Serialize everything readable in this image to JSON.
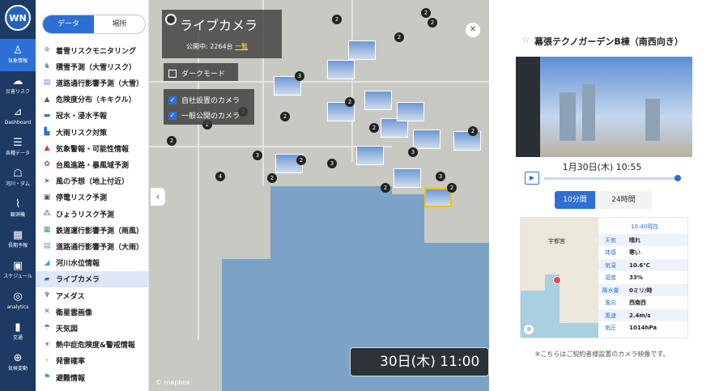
{
  "rail": {
    "logo": "WN",
    "items": [
      {
        "label": "気象情報",
        "icon": "person-pin-icon",
        "glyph": "♙"
      },
      {
        "label": "災害リスク",
        "icon": "tornado-icon",
        "glyph": "☁"
      },
      {
        "label": "Dashboard",
        "icon": "chart-icon",
        "glyph": "⊿"
      },
      {
        "label": "各種データ",
        "icon": "database-icon",
        "glyph": "☰"
      },
      {
        "label": "河川・ダム",
        "icon": "river-icon",
        "glyph": "☖"
      },
      {
        "label": "観測機",
        "icon": "graph-icon",
        "glyph": "⌇"
      },
      {
        "label": "長期予報",
        "icon": "calendar-icon",
        "glyph": "▦"
      },
      {
        "label": "スケジュール",
        "icon": "schedule-icon",
        "glyph": "▣"
      },
      {
        "label": "analytics",
        "icon": "analytics-icon",
        "glyph": "◎"
      },
      {
        "label": "交通",
        "icon": "truck-icon",
        "glyph": "▮"
      },
      {
        "label": "気候変動",
        "icon": "globe-icon",
        "glyph": "⊕"
      }
    ]
  },
  "menu": {
    "tabs": [
      "データ",
      "場所"
    ],
    "items": [
      {
        "label": "着雪リスクモニタリング",
        "glyph": "❄",
        "color": "#5b8fd6"
      },
      {
        "label": "積雪予測（大雪リスク）",
        "glyph": "♞",
        "color": "#5b8fd6"
      },
      {
        "label": "道路通行影響予測（大雪）",
        "glyph": "▤",
        "color": "#5b8fd6"
      },
      {
        "label": "危険度分布（キキクル）",
        "glyph": "▲",
        "color": "#7a5a3a"
      },
      {
        "label": "冠水・浸水予報",
        "glyph": "▬",
        "color": "#3a78c8"
      },
      {
        "label": "大雨リスク対策",
        "glyph": "▙",
        "color": "#2e6fd6"
      },
      {
        "label": "気象警報・可能性情報",
        "glyph": "▲",
        "color": "#e33b2e"
      },
      {
        "label": "台風進路・暴風域予測",
        "glyph": "✿",
        "color": "#9b3fc8"
      },
      {
        "label": "風の予想（地上付近）",
        "glyph": "➤",
        "color": "#3a78c8"
      },
      {
        "label": "停電リスク予測",
        "glyph": "▣",
        "color": "#555555"
      },
      {
        "label": "ひょうリスク予測",
        "glyph": "⁂",
        "color": "#5b8fd6"
      },
      {
        "label": "鉄道運行影響予測（雨風）",
        "glyph": "▦",
        "color": "#3aa35a"
      },
      {
        "label": "道路通行影響予測（大雨）",
        "glyph": "▤",
        "color": "#5b8fd6"
      },
      {
        "label": "河川水位情報",
        "glyph": "◢",
        "color": "#3a9fd6"
      },
      {
        "label": "ライブカメラ",
        "glyph": "▰",
        "color": "#2e6fd6"
      },
      {
        "label": "アメダス",
        "glyph": "♆",
        "color": "#555555"
      },
      {
        "label": "衛星雲画像",
        "glyph": "✕",
        "color": "#3a78c8"
      },
      {
        "label": "天気図",
        "glyph": "☂",
        "color": "#3a78c8"
      },
      {
        "label": "熱中症危険度&警戒情報",
        "glyph": "☀",
        "color": "#e64a2e"
      },
      {
        "label": "発雷確率",
        "glyph": "⚡",
        "color": "#f2b400"
      },
      {
        "label": "避難情報",
        "glyph": "⚑",
        "color": "#3aa35a"
      }
    ],
    "active_index": 14
  },
  "map": {
    "title": "ライブカメラ",
    "subtitle": "公開中: 2264台",
    "list_link": "一覧",
    "dark_mode_label": "ダークモード",
    "dark_mode_checked": false,
    "own_camera_label": "自社設置のカメラ",
    "own_camera_checked": true,
    "public_camera_label": "一般公開のカメラ",
    "public_camera_checked": true,
    "time_display": "30日(木) 11:00",
    "attribution": "© mapbox",
    "counts": [
      "2",
      "2",
      "3",
      "2",
      "2",
      "2",
      "2",
      "2",
      "4",
      "3",
      "2",
      "2",
      "3",
      "2",
      "2",
      "3",
      "2",
      "3",
      "2",
      "2",
      "2"
    ]
  },
  "panel": {
    "title": "幕張テクノガーデンB棟（南西向き）",
    "datetime": "1月30日(木) 10:55",
    "range_tabs": [
      "10分間",
      "24時間"
    ],
    "range_active": 0,
    "mini_map_label": "宇都宮",
    "weather_time": "10:40現在",
    "weather": [
      {
        "key": "天気",
        "value": "晴れ"
      },
      {
        "key": "体感",
        "value": "寒い"
      },
      {
        "key": "気温",
        "value": "10.6℃"
      },
      {
        "key": "湿度",
        "value": "33%"
      },
      {
        "key": "降水量",
        "value": "0ミリ/時"
      },
      {
        "key": "風向",
        "value": "西南西"
      },
      {
        "key": "風速",
        "value": "2.4m/s"
      },
      {
        "key": "気圧",
        "value": "1014hPa"
      }
    ],
    "note": "※こちらはご契約者様設置のカメラ映像です。"
  }
}
